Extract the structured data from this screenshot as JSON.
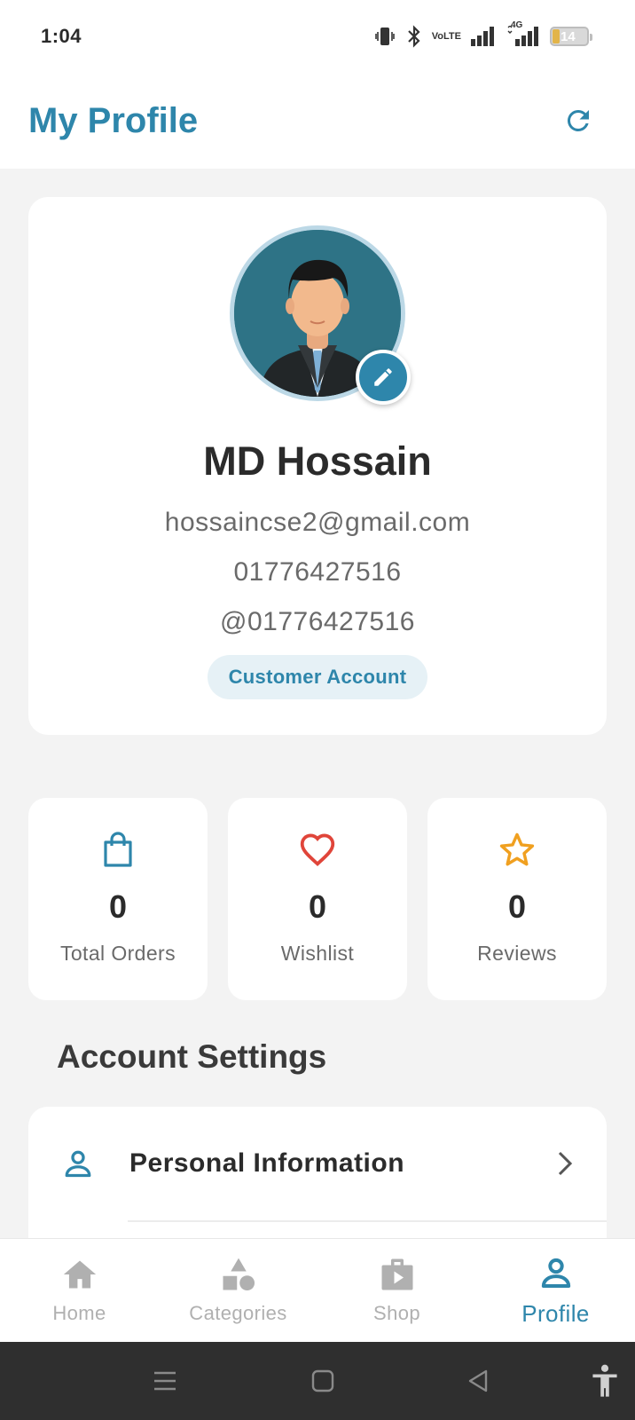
{
  "status_bar": {
    "time": "1:04",
    "network_label_top": "Vo",
    "network_label_bottom": "LTE",
    "data_type": "4G",
    "battery_level": "14"
  },
  "header": {
    "title": "My Profile",
    "refresh_icon": "refresh-icon"
  },
  "profile": {
    "name": "MD Hossain",
    "email": "hossaincse2@gmail.com",
    "phone": "01776427516",
    "username": "@01776427516",
    "account_type": "Customer Account"
  },
  "stats": [
    {
      "icon": "shopping-bag-icon",
      "value": "0",
      "label": "Total Orders",
      "color": "#2e86ab"
    },
    {
      "icon": "heart-icon",
      "value": "0",
      "label": "Wishlist",
      "color": "#e0453a"
    },
    {
      "icon": "star-icon",
      "value": "0",
      "label": "Reviews",
      "color": "#f0a020"
    }
  ],
  "account_settings": {
    "title": "Account Settings",
    "items": [
      {
        "icon": "person-icon",
        "label": "Personal Information"
      }
    ]
  },
  "bottom_nav": [
    {
      "icon": "home-icon",
      "label": "Home",
      "active": false
    },
    {
      "icon": "categories-icon",
      "label": "Categories",
      "active": false
    },
    {
      "icon": "shop-icon",
      "label": "Shop",
      "active": false
    },
    {
      "icon": "profile-icon",
      "label": "Profile",
      "active": true
    }
  ],
  "colors": {
    "accent": "#2e86ab",
    "background": "#f3f3f3",
    "inactive_nav": "#b0b0b0"
  }
}
